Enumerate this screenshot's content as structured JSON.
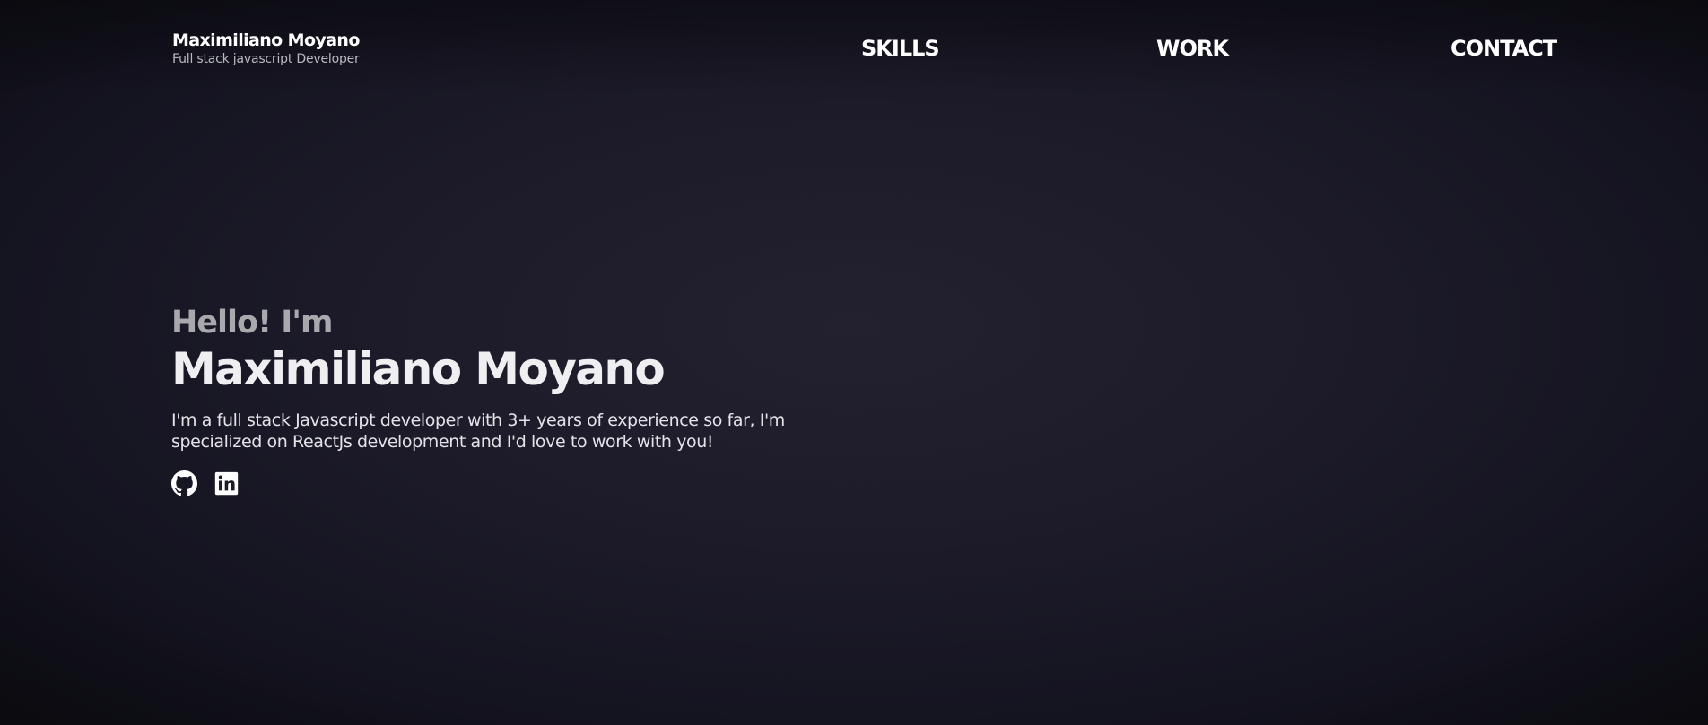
{
  "header": {
    "brand_name": "Maximiliano Moyano",
    "brand_role": "Full stack javascript Developer",
    "nav": {
      "skills": "SKILLS",
      "work": "WORK",
      "contact": "CONTACT"
    }
  },
  "hero": {
    "greeting": "Hello! I'm",
    "name": "Maximiliano Moyano",
    "description": "I'm a full stack Javascript developer with 3+ years of experience so far, I'm specialized on ReactJs development and I'd love to work with you!"
  },
  "socials": {
    "github_icon": "github-icon",
    "linkedin_icon": "linkedin-icon"
  },
  "colors": {
    "background": "#1d1b29",
    "text": "#ffffff",
    "muted": "#a8a8ad"
  }
}
